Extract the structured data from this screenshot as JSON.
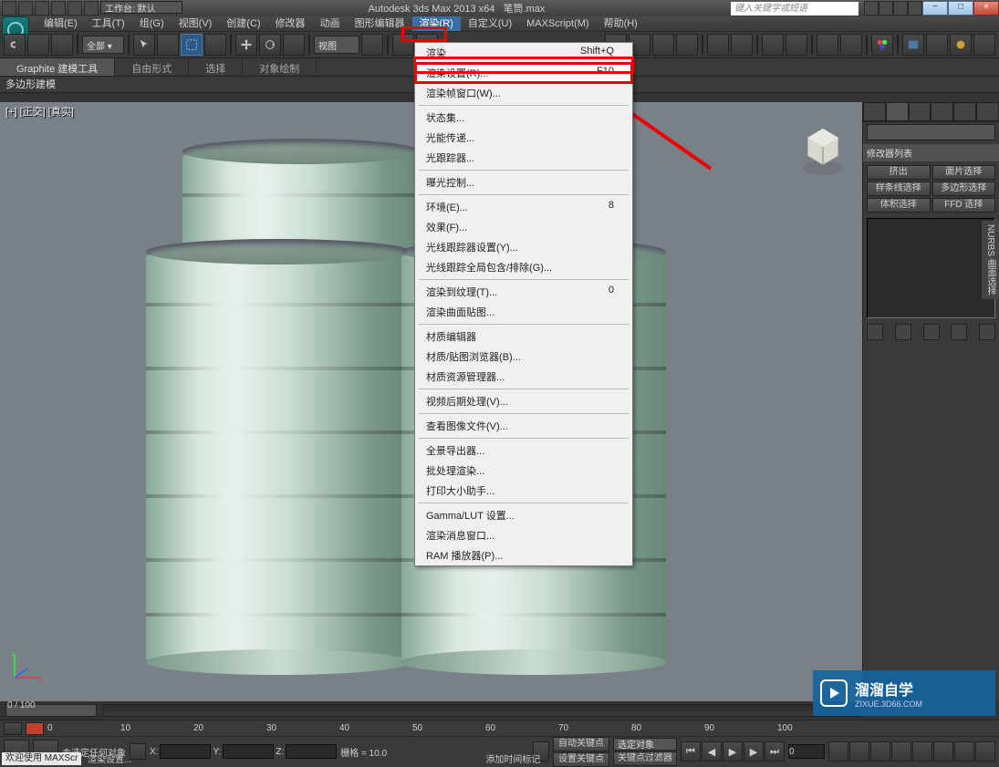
{
  "title": {
    "app": "Autodesk 3ds Max  2013 x64",
    "file": "笔筒.max",
    "search_placeholder": "键入关键字或短语"
  },
  "workspace_label": "工作台: 默认",
  "menu": [
    "编辑(E)",
    "工具(T)",
    "组(G)",
    "视图(V)",
    "创建(C)",
    "修改器",
    "动画",
    "图形编辑器",
    "渲染(R)",
    "自定义(U)",
    "MAXScript(M)",
    "帮助(H)"
  ],
  "menu_active_index": 8,
  "ribbon": {
    "tabs": [
      "Graphite 建模工具",
      "自由形式",
      "选择",
      "对象绘制"
    ],
    "sub": "多边形建模"
  },
  "viewport_label": "[+] [正交] [真实]",
  "view_combo": "视图",
  "dropdown": [
    {
      "label": "渲染",
      "shortcut": "Shift+Q"
    },
    {
      "label": "渲染设置(R)...",
      "shortcut": "F10",
      "hl": true
    },
    {
      "label": "渲染帧窗口(W)..."
    },
    {
      "sep": true
    },
    {
      "label": "状态集..."
    },
    {
      "label": "光能传递..."
    },
    {
      "label": "光跟踪器..."
    },
    {
      "sep": true
    },
    {
      "label": "曝光控制..."
    },
    {
      "sep": true
    },
    {
      "label": "环境(E)...",
      "shortcut": "8"
    },
    {
      "label": "效果(F)..."
    },
    {
      "label": "光线跟踪器设置(Y)..."
    },
    {
      "label": "光线跟踪全局包含/排除(G)..."
    },
    {
      "sep": true
    },
    {
      "label": "渲染到纹理(T)...",
      "shortcut": "0"
    },
    {
      "label": "渲染曲面贴图..."
    },
    {
      "sep": true
    },
    {
      "label": "材质编辑器"
    },
    {
      "label": "材质/贴图浏览器(B)..."
    },
    {
      "label": "材质资源管理器..."
    },
    {
      "sep": true
    },
    {
      "label": "视频后期处理(V)..."
    },
    {
      "sep": true
    },
    {
      "label": "查看图像文件(V)..."
    },
    {
      "sep": true
    },
    {
      "label": "全景导出器..."
    },
    {
      "label": "批处理渲染..."
    },
    {
      "label": "打印大小助手..."
    },
    {
      "sep": true
    },
    {
      "label": "Gamma/LUT 设置..."
    },
    {
      "label": "渲染消息窗口..."
    },
    {
      "label": "RAM 播放器(P)..."
    }
  ],
  "cmd": {
    "list_label": "修改器列表",
    "buttons": [
      "挤出",
      "面片选择",
      "样条线选择",
      "多边形选择",
      "体积选择",
      "FFD 选择"
    ],
    "side_label": "NURBS 曲面选择"
  },
  "time": {
    "range": "0 / 100",
    "ticks": [
      0,
      10,
      20,
      30,
      40,
      50,
      60,
      70,
      80,
      90,
      100
    ]
  },
  "status": {
    "none_selected": "未选定任何对象",
    "sel_label": "选定对象",
    "welcome": "欢迎使用 MAXScr",
    "render_setup": "渲染设置...",
    "x": "X:",
    "y": "Y:",
    "z": "Z:",
    "grid": "栅格 = 10.0",
    "autokey": "自动关键点",
    "setkey": "设置关键点",
    "keyfilter": "关键点过滤器",
    "addtime": "添加时间标记"
  },
  "watermark": {
    "big": "溜溜自学",
    "small": "ZIXUE.3D66.COM"
  }
}
